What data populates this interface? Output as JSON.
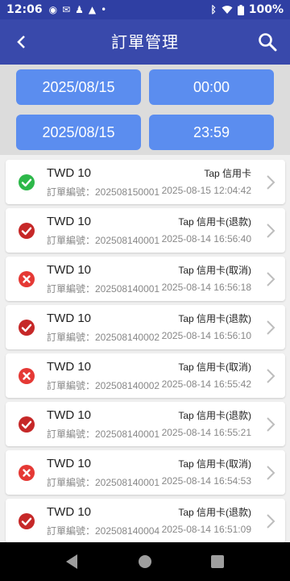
{
  "status_bar": {
    "time": "12:06",
    "battery": "100%"
  },
  "header": {
    "title": "訂單管理"
  },
  "filters": {
    "start_date": "2025/08/15",
    "start_time": "00:00",
    "end_date": "2025/08/15",
    "end_time": "23:59"
  },
  "orders": [
    {
      "status": "success",
      "amount": "TWD 10",
      "payment": "Tap 信用卡",
      "order_no": "訂單編號：202508150001",
      "datetime": "2025-08-15 12:04:42"
    },
    {
      "status": "refunded",
      "amount": "TWD 10",
      "payment": "Tap 信用卡(退款)",
      "order_no": "訂單編號：202508140001",
      "datetime": "2025-08-14 16:56:40"
    },
    {
      "status": "cancelled",
      "amount": "TWD 10",
      "payment": "Tap 信用卡(取消)",
      "order_no": "訂單編號：202508140001",
      "datetime": "2025-08-14 16:56:18"
    },
    {
      "status": "refunded",
      "amount": "TWD 10",
      "payment": "Tap 信用卡(退款)",
      "order_no": "訂單編號：202508140002",
      "datetime": "2025-08-14 16:56:10"
    },
    {
      "status": "cancelled",
      "amount": "TWD 10",
      "payment": "Tap 信用卡(取消)",
      "order_no": "訂單編號：202508140002",
      "datetime": "2025-08-14 16:55:42"
    },
    {
      "status": "refunded",
      "amount": "TWD 10",
      "payment": "Tap 信用卡(退款)",
      "order_no": "訂單編號：202508140001",
      "datetime": "2025-08-14 16:55:21"
    },
    {
      "status": "cancelled",
      "amount": "TWD 10",
      "payment": "Tap 信用卡(取消)",
      "order_no": "訂單編號：202508140001",
      "datetime": "2025-08-14 16:54:53"
    },
    {
      "status": "refunded",
      "amount": "TWD 10",
      "payment": "Tap 信用卡(退款)",
      "order_no": "訂單編號：202508140004",
      "datetime": "2025-08-14 16:51:09"
    }
  ],
  "colors": {
    "app_bar": "#3949ab",
    "status_bar": "#2f3fa3",
    "filter_button": "#5b8def",
    "success": "#2db84a",
    "refunded": "#c62828",
    "cancelled": "#e53935"
  },
  "icons": {
    "back": "back-arrow-icon",
    "search": "search-icon",
    "success": "check-circle-icon",
    "refunded": "check-circle-icon",
    "cancelled": "x-circle-icon",
    "row_action": "chevron-right-icon"
  }
}
